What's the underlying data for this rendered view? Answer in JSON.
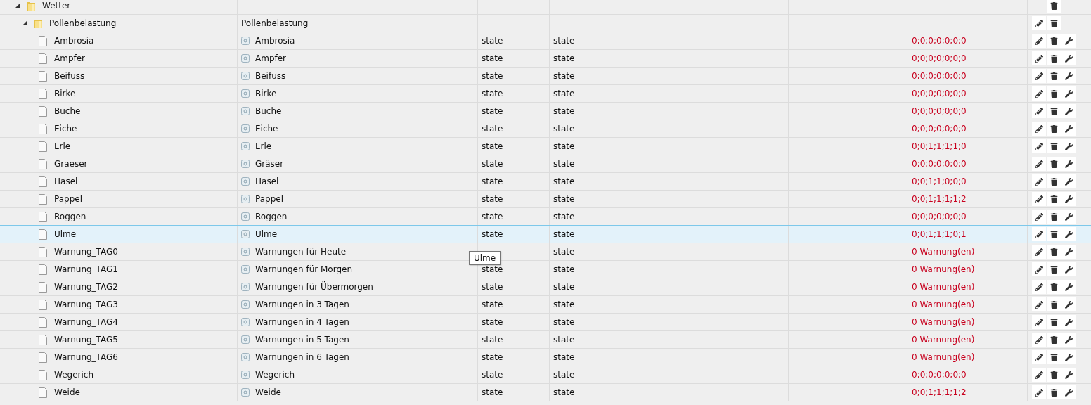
{
  "tree": [
    {
      "name": "Wetter",
      "expanded": true,
      "selected": false,
      "actions": [
        {
          "kind": "delete"
        }
      ],
      "children": [
        {
          "name": "Pollenbelastung",
          "description": "Pollenbelastung",
          "expanded": true,
          "selected": false,
          "actions": [
            {
              "kind": "edit"
            },
            {
              "kind": "delete"
            }
          ],
          "children": [
            {
              "name": "Ambrosia",
              "description": "Ambrosia",
              "type": "state",
              "role": "state",
              "value": "0;0;0;0;0;0;0",
              "selected": false,
              "actions": [
                {
                  "kind": "edit"
                },
                {
                  "kind": "delete"
                },
                {
                  "kind": "config"
                }
              ]
            },
            {
              "name": "Ampfer",
              "description": "Ampfer",
              "type": "state",
              "role": "state",
              "value": "0;0;0;0;0;0;0",
              "selected": false,
              "actions": [
                {
                  "kind": "edit"
                },
                {
                  "kind": "delete"
                },
                {
                  "kind": "config"
                }
              ]
            },
            {
              "name": "Beifuss",
              "description": "Beifuss",
              "type": "state",
              "role": "state",
              "value": "0;0;0;0;0;0;0",
              "selected": false,
              "actions": [
                {
                  "kind": "edit"
                },
                {
                  "kind": "delete"
                },
                {
                  "kind": "config"
                }
              ]
            },
            {
              "name": "Birke",
              "description": "Birke",
              "type": "state",
              "role": "state",
              "value": "0;0;0;0;0;0;0",
              "selected": false,
              "actions": [
                {
                  "kind": "edit"
                },
                {
                  "kind": "delete"
                },
                {
                  "kind": "config"
                }
              ]
            },
            {
              "name": "Buche",
              "description": "Buche",
              "type": "state",
              "role": "state",
              "value": "0;0;0;0;0;0;0",
              "selected": false,
              "actions": [
                {
                  "kind": "edit"
                },
                {
                  "kind": "delete"
                },
                {
                  "kind": "config"
                }
              ]
            },
            {
              "name": "Eiche",
              "description": "Eiche",
              "type": "state",
              "role": "state",
              "value": "0;0;0;0;0;0;0",
              "selected": false,
              "actions": [
                {
                  "kind": "edit"
                },
                {
                  "kind": "delete"
                },
                {
                  "kind": "config"
                }
              ]
            },
            {
              "name": "Erle",
              "description": "Erle",
              "type": "state",
              "role": "state",
              "value": "0;0;1;1;1;1;0",
              "selected": false,
              "actions": [
                {
                  "kind": "edit"
                },
                {
                  "kind": "delete"
                },
                {
                  "kind": "config"
                }
              ]
            },
            {
              "name": "Graeser",
              "description": "Gräser",
              "type": "state",
              "role": "state",
              "value": "0;0;0;0;0;0;0",
              "selected": false,
              "actions": [
                {
                  "kind": "edit"
                },
                {
                  "kind": "delete"
                },
                {
                  "kind": "config"
                }
              ]
            },
            {
              "name": "Hasel",
              "description": "Hasel",
              "type": "state",
              "role": "state",
              "value": "0;0;1;1;0;0;0",
              "selected": false,
              "actions": [
                {
                  "kind": "edit"
                },
                {
                  "kind": "delete"
                },
                {
                  "kind": "config"
                }
              ]
            },
            {
              "name": "Pappel",
              "description": "Pappel",
              "type": "state",
              "role": "state",
              "value": "0;0;1;1;1;1;2",
              "selected": false,
              "actions": [
                {
                  "kind": "edit"
                },
                {
                  "kind": "delete"
                },
                {
                  "kind": "config"
                }
              ]
            },
            {
              "name": "Roggen",
              "description": "Roggen",
              "type": "state",
              "role": "state",
              "value": "0;0;0;0;0;0;0",
              "selected": false,
              "actions": [
                {
                  "kind": "edit"
                },
                {
                  "kind": "delete"
                },
                {
                  "kind": "config"
                }
              ]
            },
            {
              "name": "Ulme",
              "description": "Ulme",
              "type": "state",
              "role": "state",
              "value": "0;0;1;1;1;0;1",
              "selected": true,
              "actions": [
                {
                  "kind": "edit"
                },
                {
                  "kind": "delete"
                },
                {
                  "kind": "config"
                }
              ]
            },
            {
              "name": "Warnung_TAG0",
              "description": "Warnungen für Heute",
              "role": "state",
              "value": "0 Warnung(en)",
              "selected": false,
              "actions": [
                {
                  "kind": "edit"
                },
                {
                  "kind": "delete"
                },
                {
                  "kind": "config"
                }
              ]
            },
            {
              "name": "Warnung_TAG1",
              "description": "Warnungen für Morgen",
              "type": "state",
              "role": "state",
              "value": "0 Warnung(en)",
              "selected": false,
              "actions": [
                {
                  "kind": "edit"
                },
                {
                  "kind": "delete"
                },
                {
                  "kind": "config"
                }
              ]
            },
            {
              "name": "Warnung_TAG2",
              "description": "Warnungen für Übermorgen",
              "type": "state",
              "role": "state",
              "value": "0 Warnung(en)",
              "selected": false,
              "actions": [
                {
                  "kind": "edit"
                },
                {
                  "kind": "delete"
                },
                {
                  "kind": "config"
                }
              ]
            },
            {
              "name": "Warnung_TAG3",
              "description": "Warnungen in 3 Tagen",
              "type": "state",
              "role": "state",
              "value": "0 Warnung(en)",
              "selected": false,
              "actions": [
                {
                  "kind": "edit"
                },
                {
                  "kind": "delete"
                },
                {
                  "kind": "config"
                }
              ]
            },
            {
              "name": "Warnung_TAG4",
              "description": "Warnungen in 4 Tagen",
              "type": "state",
              "role": "state",
              "value": "0 Warnung(en)",
              "selected": false,
              "actions": [
                {
                  "kind": "edit"
                },
                {
                  "kind": "delete"
                },
                {
                  "kind": "config"
                }
              ]
            },
            {
              "name": "Warnung_TAG5",
              "description": "Warnungen in 5 Tagen",
              "type": "state",
              "role": "state",
              "value": "0 Warnung(en)",
              "selected": false,
              "actions": [
                {
                  "kind": "edit"
                },
                {
                  "kind": "delete"
                },
                {
                  "kind": "config"
                }
              ]
            },
            {
              "name": "Warnung_TAG6",
              "description": "Warnungen in 6 Tagen",
              "type": "state",
              "role": "state",
              "value": "0 Warnung(en)",
              "selected": false,
              "actions": [
                {
                  "kind": "edit"
                },
                {
                  "kind": "delete"
                },
                {
                  "kind": "config"
                }
              ]
            },
            {
              "name": "Wegerich",
              "description": "Wegerich",
              "type": "state",
              "role": "state",
              "value": "0;0;0;0;0;0;0",
              "selected": false,
              "actions": [
                {
                  "kind": "edit"
                },
                {
                  "kind": "delete"
                },
                {
                  "kind": "config"
                }
              ]
            },
            {
              "name": "Weide",
              "description": "Weide",
              "type": "state",
              "role": "state",
              "value": "0;0;1;1;1;1;2",
              "selected": false,
              "actions": [
                {
                  "kind": "edit"
                },
                {
                  "kind": "delete"
                },
                {
                  "kind": "config"
                }
              ]
            }
          ]
        }
      ]
    }
  ],
  "tooltip": {
    "text": "Ulme"
  }
}
